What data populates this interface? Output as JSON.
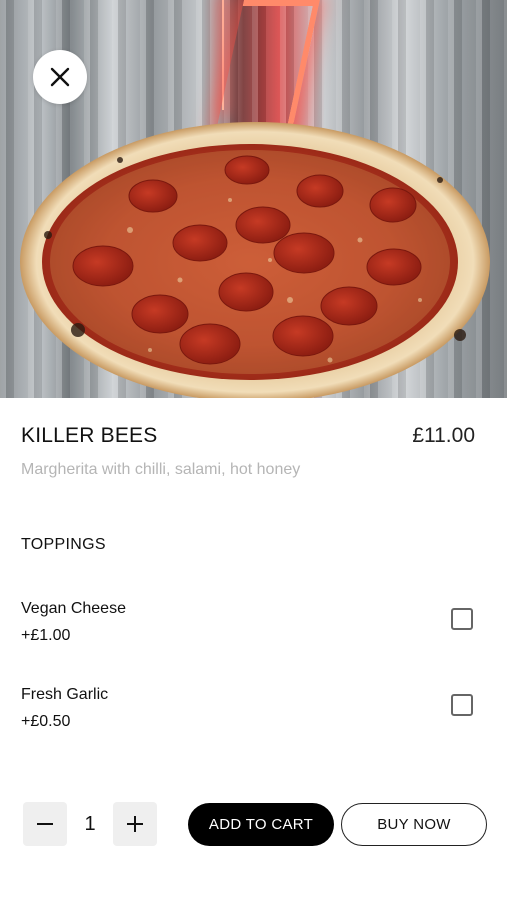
{
  "item": {
    "name": "KILLER BEES",
    "price": "£11.00",
    "description": "Margherita with chilli, salami, hot honey",
    "image_icon": "pizza-photo"
  },
  "close": {
    "icon": "close-icon"
  },
  "toppings": {
    "label": "TOPPINGS",
    "options": [
      {
        "name": "Vegan Cheese",
        "extra": "+£1.00",
        "checked": false
      },
      {
        "name": "Fresh Garlic",
        "extra": "+£0.50",
        "checked": false
      }
    ]
  },
  "quantity": {
    "value": "1",
    "minus_icon": "minus-icon",
    "plus_icon": "plus-icon"
  },
  "actions": {
    "add_to_cart": "ADD TO CART",
    "buy_now": "BUY NOW"
  },
  "colors": {
    "primary": "#000000",
    "muted_text": "#b5b5b5",
    "stepper_bg": "#efefef"
  }
}
